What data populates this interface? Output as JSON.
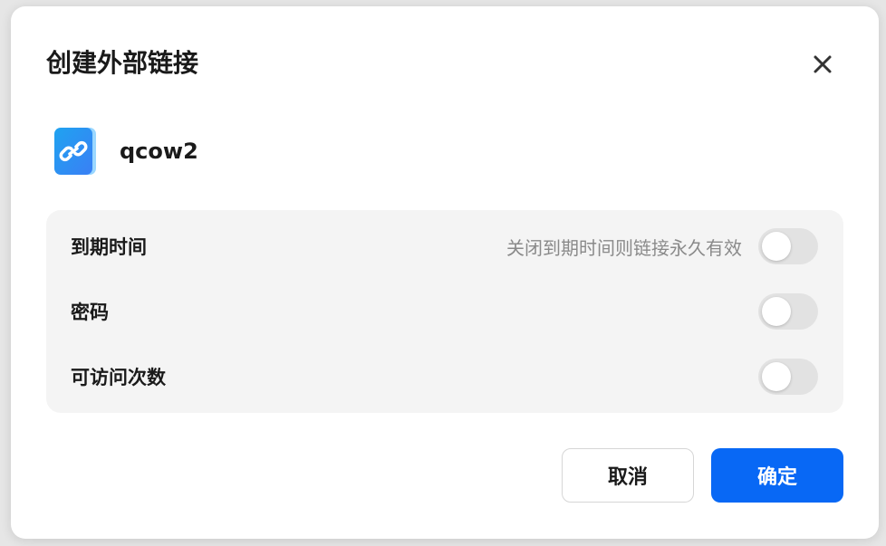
{
  "dialog": {
    "title": "创建外部链接",
    "close_icon": "close-icon"
  },
  "file": {
    "icon": "link-file-icon",
    "name": "qcow2"
  },
  "settings": {
    "expiry": {
      "label": "到期时间",
      "hint": "关闭到期时间则链接永久有效",
      "enabled": false
    },
    "password": {
      "label": "密码",
      "enabled": false
    },
    "visit_limit": {
      "label": "可访问次数",
      "enabled": false
    }
  },
  "actions": {
    "cancel_label": "取消",
    "confirm_label": "确定"
  },
  "colors": {
    "accent": "#0868f5",
    "panel_bg": "#f4f4f4",
    "toggle_off": "#e2e2e2"
  }
}
